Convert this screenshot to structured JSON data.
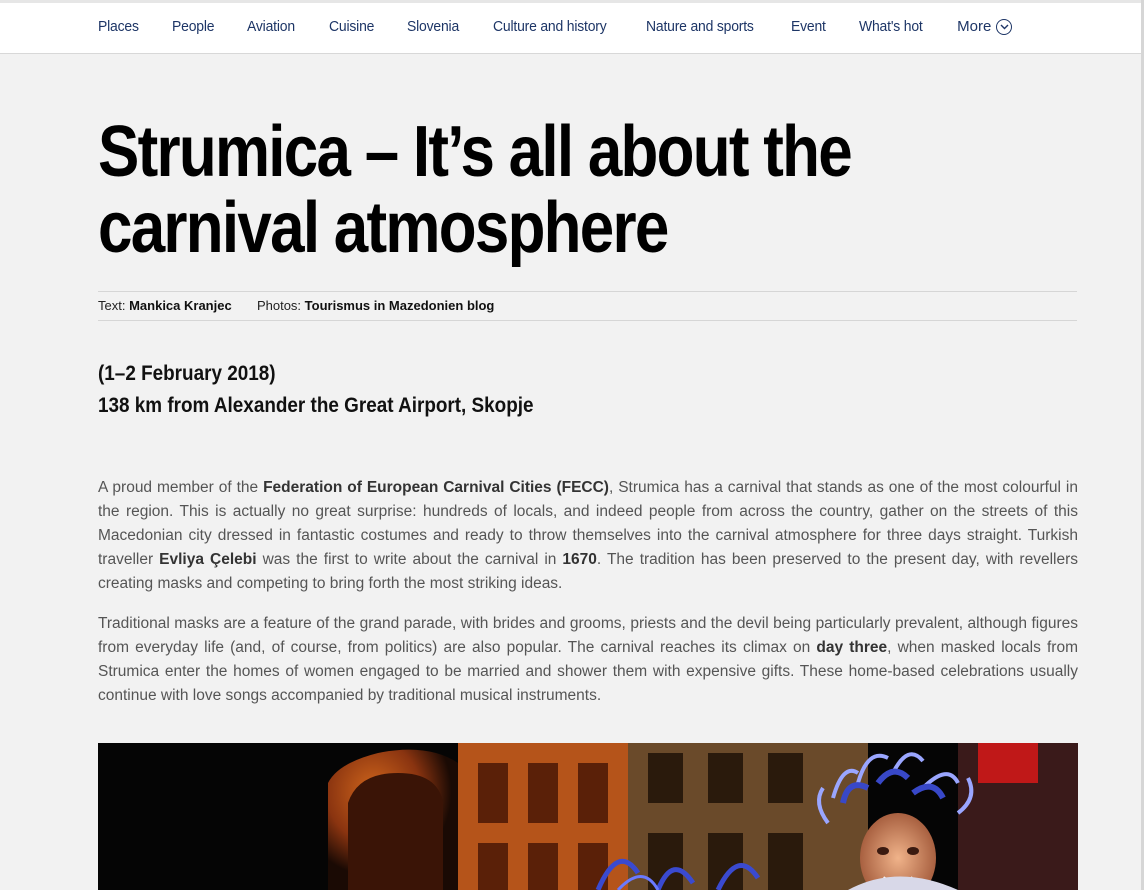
{
  "nav": {
    "items": [
      "Places",
      "People",
      "Aviation",
      "Cuisine",
      "Slovenia",
      "Culture and history",
      "Nature and sports",
      "Event",
      "What's hot"
    ],
    "more_label": "More"
  },
  "article": {
    "title": "Strumica – It’s all about the carnival atmosphere",
    "credits": {
      "text_label": "Text:",
      "author": "Mankica Kranjec",
      "photos_label": "Photos:",
      "photographer": "Tourismus in Mazedonien blog"
    },
    "date": "(1–2 February 2018)",
    "distance": "138 km from Alexander the Great Airport, Skopje",
    "p1": {
      "s1": "A proud member of the ",
      "b1": "Federation of European Carnival Cities (FECC)",
      "s2": ", Strumica has a carnival that stands as one of the most colourful in the region. This is actually no great surprise: hundreds of locals, and indeed people from across the country, gather on the streets of this Macedonian city dressed in fantastic costumes and ready to throw themselves into the carnival atmosphere for three days straight. Turkish traveller ",
      "b2": "Evliya Çelebi",
      "s3": " was the first to write about the carnival in ",
      "b3": "1670",
      "s4": ". The tradition has been preserved to the present day, with revellers creating masks and competing to bring forth the most striking ideas."
    },
    "p2": {
      "s1": "Traditional masks are a feature of the grand parade, with brides and grooms, priests and the devil being particularly prevalent, although figures from everyday life (and, of course, from politics) are also popular. The carnival reaches its climax on ",
      "b1": "day three",
      "s2": ", when masked locals from Strumica enter the homes of women engaged to be married and shower them with expensive gifts. These home-based celebrations usually continue with love songs accompanied by traditional musical instruments."
    }
  },
  "colors": {
    "nav_text": "#1d3566",
    "body_text": "#555555",
    "background": "#f2f2f2"
  },
  "icons": {
    "more": "chevron-down-circle-icon"
  }
}
